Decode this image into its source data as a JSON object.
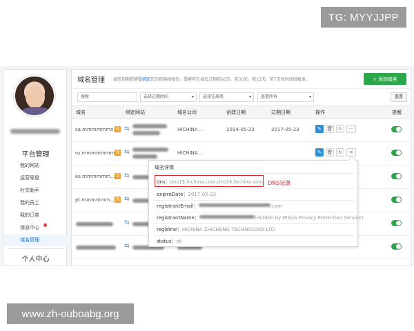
{
  "watermarks": {
    "telegram": "TG: MYYJJPP",
    "site": "www.zh-ouboabg.org"
  },
  "sidebar": {
    "section_platform": "平台管理",
    "items": [
      {
        "label": "我的网站"
      },
      {
        "label": "运营导盘"
      },
      {
        "label": "社交助手"
      },
      {
        "label": "我的员工"
      },
      {
        "label": "我的订单"
      },
      {
        "label": "消息中心"
      },
      {
        "label": "域名管理"
      }
    ],
    "section_personal": "个人中心"
  },
  "main": {
    "title": "域名管理",
    "tip_prefix": "域名到期提醒要",
    "tip_link": "绑定",
    "tip_suffix": "您的邮箱和微信。提醒将在域名过期前60天、前30天、前15天、前7天每时间段触发。",
    "add_button": "添加域名",
    "add_icon": "+",
    "filters": {
      "search_placeholder": "搜索",
      "expire_select": "选择过期时间",
      "registrar_select": "选择注册商",
      "view_select": "查看所有"
    },
    "reset_button": "重置",
    "columns": {
      "domain": "域名",
      "bound_site": "绑定网站",
      "registrar": "域名公司",
      "created": "创建日期",
      "expires": "过期日期",
      "actions": "操作",
      "reminder": "提醒"
    },
    "rows": [
      {
        "domain": "sa.mmmmmmn...",
        "registrar": "HICHINA ...",
        "created": "2014-05-23",
        "expires": "2017-05-23",
        "reminder_on": true
      },
      {
        "domain": "ru.mmmmmmm...",
        "registrar": "HICHINA ...",
        "created": "",
        "expires": "",
        "reminder_on": true
      },
      {
        "domain": "es.mmmmmm...",
        "registrar": "",
        "created": "",
        "expires": "",
        "reminder_on": true
      },
      {
        "domain": "pt.mmmmmm...",
        "registrar": "",
        "created": "",
        "expires": "",
        "reminder_on": true
      },
      {
        "domain": "",
        "registrar": "",
        "created": "",
        "expires": "",
        "reminder_on": true
      },
      {
        "domain": "",
        "registrar": "",
        "created": "",
        "expires": "",
        "reminder_on": true
      }
    ],
    "row_icons": {
      "badge": "众",
      "link": "⇆",
      "edit": "✎",
      "delete": "🗑",
      "refresh": "↻",
      "more": "···",
      "close": "✕"
    }
  },
  "popup": {
    "title": "域名详情",
    "dns_label": "dns：",
    "dns_value": "dns13.hichina.com,dns14.hichina.com",
    "dns_note": "DNS记录",
    "expire_label": "expireDate：",
    "expire_value": "2017-05-23",
    "email_label": "registrantEmail：",
    "email_value": ".com",
    "name_label": "registrantName：",
    "name_value": "(Hidden by Whois Privacy Protection Service)",
    "registrar_label": "registrar：",
    "registrar_value": "HICHINA ZHICHENG TECHNOLOGY LTD.",
    "status_label": "status：",
    "status_value": "ok"
  },
  "colors": {
    "accent_green": "#2ba74a",
    "link_blue": "#1a73c8",
    "highlight_red": "#d9262d"
  }
}
